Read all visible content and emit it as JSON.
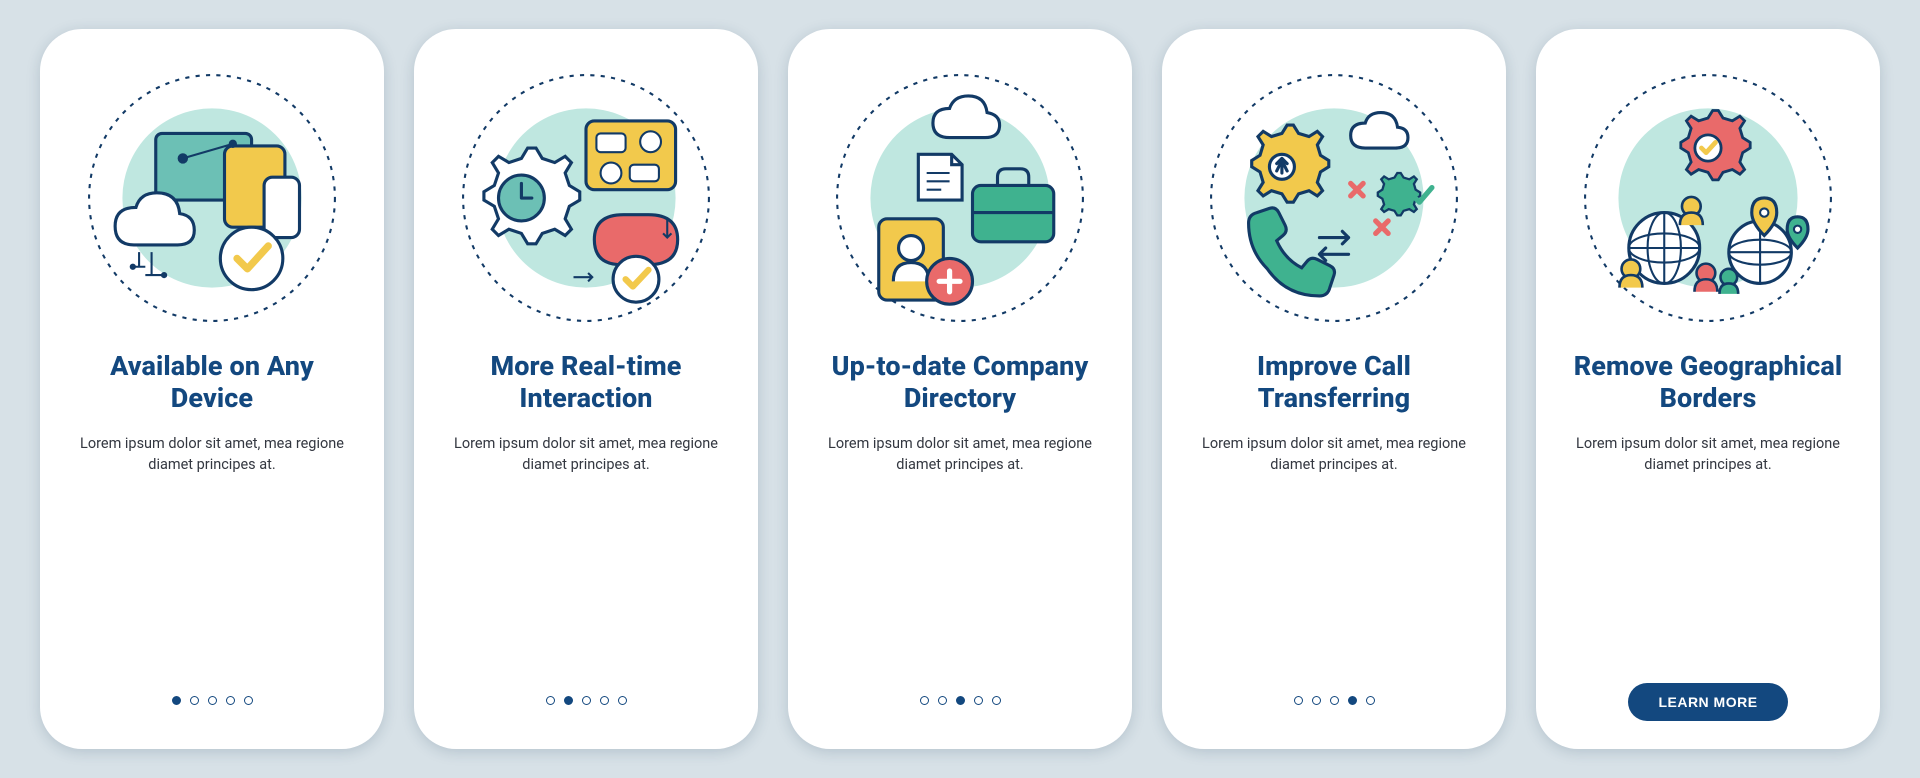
{
  "colors": {
    "stroke": "#123a66",
    "teal": "#6cc0b5",
    "tealLt": "#bfe7e0",
    "green": "#3fb28f",
    "yellow": "#f2c94c",
    "red": "#e96a6a",
    "navy": "#13487f"
  },
  "lorem": "Lorem ipsum dolor sit amet, mea regione diamet principes at.",
  "cta_label": "LEARN MORE",
  "cards": [
    {
      "title": "Available on Any Device"
    },
    {
      "title": "More Real-time Interaction"
    },
    {
      "title": "Up-to-date Company Directory"
    },
    {
      "title": "Improve Call Transferring"
    },
    {
      "title": "Remove Geographical Borders"
    }
  ],
  "total_dots": 5
}
